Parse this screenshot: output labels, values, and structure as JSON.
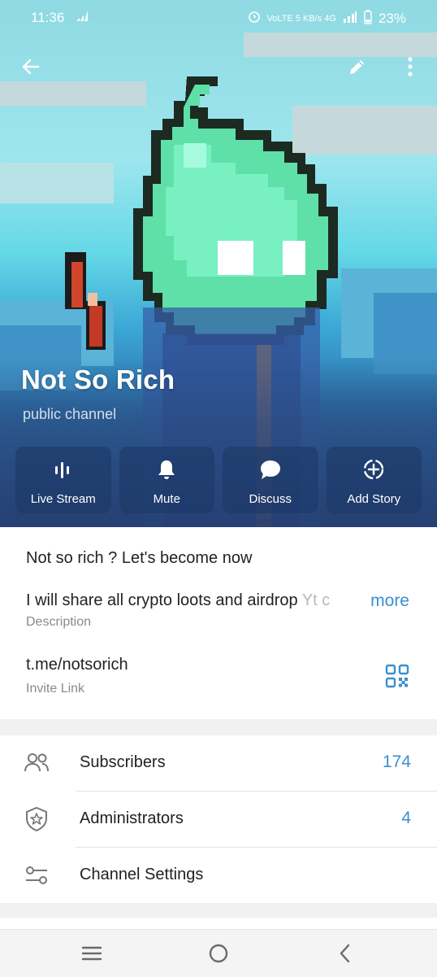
{
  "status_bar": {
    "time": "11:36",
    "indicators": "VoLTE  5 KB/s  4G",
    "battery": "23%"
  },
  "top_bar": {
    "back_icon": "arrow-left-icon",
    "edit_icon": "pencil-icon",
    "menu_icon": "more-vertical-icon"
  },
  "channel": {
    "name": "Not So Rich",
    "type": "public channel"
  },
  "actions": [
    {
      "label": "Live Stream",
      "icon": "live-stream-icon"
    },
    {
      "label": "Mute",
      "icon": "bell-icon"
    },
    {
      "label": "Discuss",
      "icon": "chat-bubble-icon"
    },
    {
      "label": "Add Story",
      "icon": "add-story-icon"
    }
  ],
  "info": {
    "description_line1": "Not so rich ? Let's become now",
    "description_line2": "I will share all crypto loots and airdrop",
    "description_fade": "Yt c",
    "more_label": "more",
    "description_label": "Description",
    "invite_link": "t.me/notsorich",
    "invite_label": "Invite Link"
  },
  "rows": [
    {
      "label": "Subscribers",
      "value": "174",
      "icon": "users-icon"
    },
    {
      "label": "Administrators",
      "value": "4",
      "icon": "shield-star-icon"
    },
    {
      "label": "Channel Settings",
      "value": "",
      "icon": "sliders-icon"
    }
  ],
  "colors": {
    "accent": "#3a8fd0",
    "sky": "#8fd9e2",
    "avatar_green": "#5ee0a8"
  }
}
